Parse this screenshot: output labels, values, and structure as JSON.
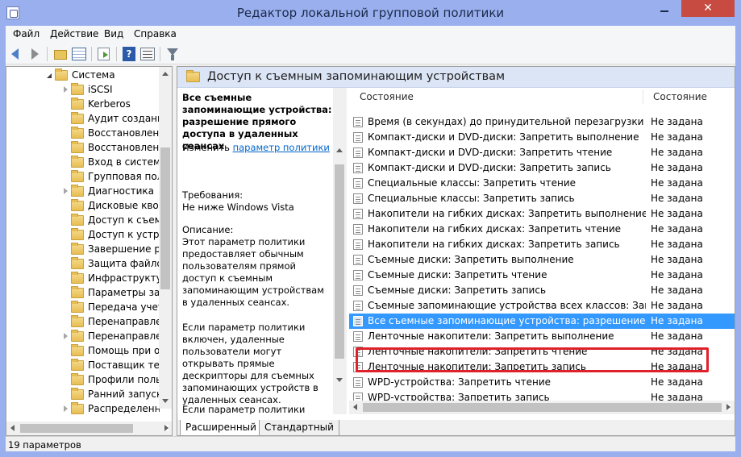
{
  "window": {
    "title": "Редактор локальной групповой политики",
    "close_symbol": "✕"
  },
  "menu": [
    "Файл",
    "Действие",
    "Вид",
    "Справка"
  ],
  "toolbar": {
    "icons": [
      "back-icon",
      "forward-icon",
      "up-folder-icon",
      "show-hide-tree-icon",
      "export-list-icon",
      "help-icon",
      "properties-icon",
      "filter-icon"
    ],
    "help_glyph": "?"
  },
  "tree": {
    "items": [
      {
        "label": "Система",
        "expanded": true
      },
      {
        "label": "iSCSI",
        "expander": true
      },
      {
        "label": "Kerberos",
        "expander": false
      },
      {
        "label": "Аудит создания",
        "expander": false
      },
      {
        "label": "Восстановлени",
        "expander": false
      },
      {
        "label": "Восстановлени",
        "expander": false
      },
      {
        "label": "Вход в систему",
        "expander": false
      },
      {
        "label": "Групповая поли",
        "expander": false
      },
      {
        "label": "Диагностика",
        "expander": true
      },
      {
        "label": "Дисковые квоты",
        "expander": false
      },
      {
        "label": "Доступ к съемн",
        "expander": false
      },
      {
        "label": "Доступ к устрой",
        "expander": false
      },
      {
        "label": "Завершение раб",
        "expander": false
      },
      {
        "label": "Защита файлов",
        "expander": false
      },
      {
        "label": "Инфраструктура",
        "expander": false
      },
      {
        "label": "Параметры заве",
        "expander": false
      },
      {
        "label": "Передача учетн",
        "expander": false
      },
      {
        "label": "Перенаправлени",
        "expander": false
      },
      {
        "label": "Перенаправлени",
        "expander": true
      },
      {
        "label": "Помощь при ош",
        "expander": false
      },
      {
        "label": "Поставщик тене",
        "expander": false
      },
      {
        "label": "Профили польз",
        "expander": false
      },
      {
        "label": "Ранний запуск а",
        "expander": false
      },
      {
        "label": "Распределенная",
        "expander": true
      }
    ]
  },
  "right": {
    "header_title": "Доступ к съемным запоминающим устройствам",
    "description": {
      "policy_title": "Все съемные запоминающие устройства: разрешение прямого доступа в удаленных сеансах",
      "edit_prefix": "Изменить ",
      "edit_link": "параметр политики",
      "requirements_label": "Требования:",
      "requirements_value": "Не ниже Windows Vista",
      "description_label": "Описание:",
      "description_text": "Этот параметр политики предоставляет обычным пользователям прямой доступ к съемным запоминающим устройствам в удаленных сеансах.",
      "enabled_text": "Если параметр политики включен, удаленные пользователи могут открывать прямые дескрипторы для съемных запоминающих устройств в удаленных сеансах.",
      "disabled_text": "Если параметр политики отключен или не настроен,"
    },
    "columns": {
      "name": "Состояние",
      "state": "Состояние"
    },
    "rows": [
      {
        "name": "Время (в секундах) до принудительной перезагрузки",
        "state": "Не задана"
      },
      {
        "name": "Компакт-диски и DVD-диски: Запретить выполнение",
        "state": "Не задана"
      },
      {
        "name": "Компакт-диски и DVD-диски: Запретить чтение",
        "state": "Не задана"
      },
      {
        "name": "Компакт-диски и DVD-диски: Запретить запись",
        "state": "Не задана"
      },
      {
        "name": "Специальные классы: Запретить чтение",
        "state": "Не задана"
      },
      {
        "name": "Специальные классы: Запретить запись",
        "state": "Не задана"
      },
      {
        "name": "Накопители на гибких дисках: Запретить выполнение",
        "state": "Не задана"
      },
      {
        "name": "Накопители на гибких дисках: Запретить чтение",
        "state": "Не задана"
      },
      {
        "name": "Накопители на гибких дисках: Запретить запись",
        "state": "Не задана"
      },
      {
        "name": "Съемные диски: Запретить выполнение",
        "state": "Не задана"
      },
      {
        "name": "Съемные диски: Запретить чтение",
        "state": "Не задана"
      },
      {
        "name": "Съемные диски: Запретить запись",
        "state": "Не задана"
      },
      {
        "name": "Съемные запоминающие устройства всех классов: Запр...",
        "state": "Не задана"
      },
      {
        "name": "Все съемные запоминающие устройства: разрешение п...",
        "state": "Не задана",
        "selected": true
      },
      {
        "name": "Ленточные накопители: Запретить выполнение",
        "state": "Не задана"
      },
      {
        "name": "Ленточные накопители: Запретить чтение",
        "state": "Не задана"
      },
      {
        "name": "Ленточные накопители: Запретить запись",
        "state": "Не задана"
      },
      {
        "name": "WPD-устройства: Запретить чтение",
        "state": "Не задана"
      },
      {
        "name": "WPD-устройства: Запретить запись",
        "state": "Не задана"
      }
    ],
    "tabs": [
      "Расширенный",
      "Стандартный"
    ]
  },
  "status": {
    "text": "19 параметров"
  },
  "colors": {
    "selection": "#3399ff",
    "highlight_box": "#e0202a",
    "link": "#0066cc"
  }
}
